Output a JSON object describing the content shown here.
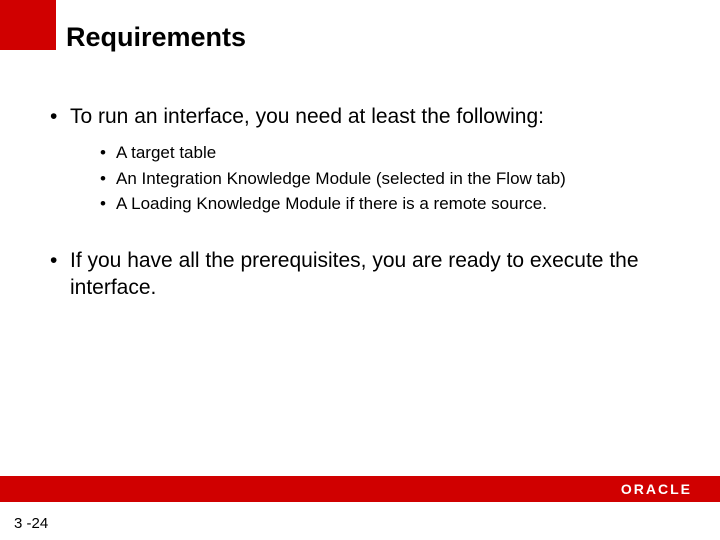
{
  "title": "Requirements",
  "bullets": {
    "main1": "To run an interface, you need at least the following:",
    "sub1": "A target table",
    "sub2": "An Integration Knowledge Module (selected in the Flow tab)",
    "sub3": "A Loading Knowledge Module if there is a remote source.",
    "main2": "If you have all the prerequisites, you are ready to execute the interface."
  },
  "footer": {
    "logo": "ORACLE",
    "slide_number": "3 -24"
  }
}
